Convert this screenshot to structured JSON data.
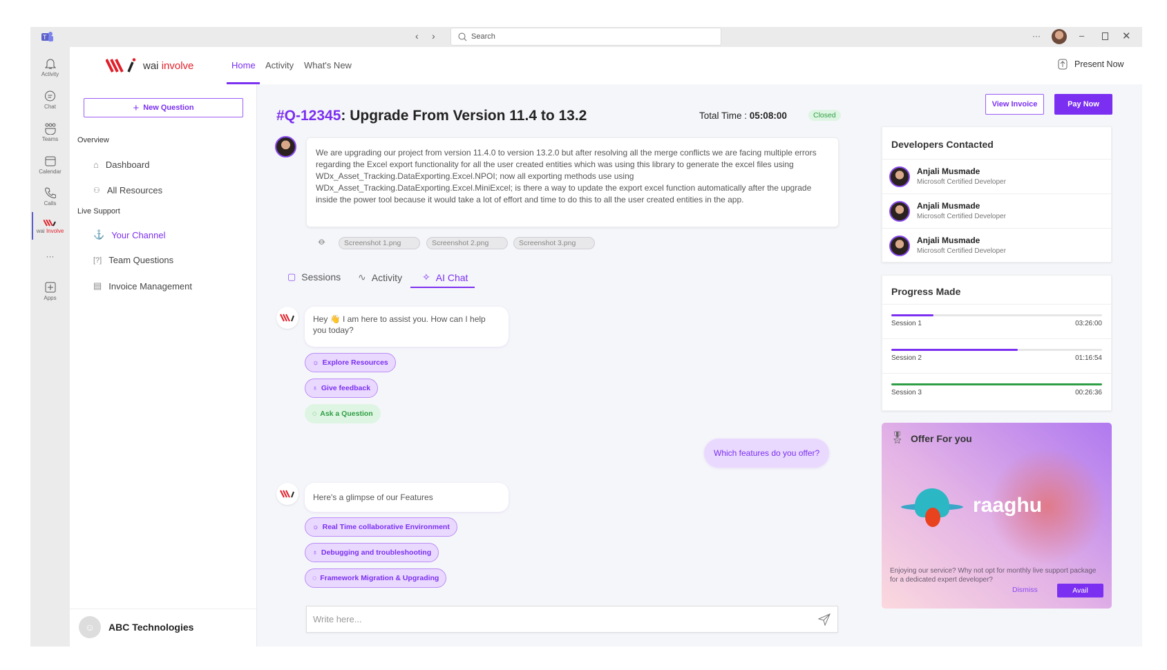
{
  "titlebar": {
    "search_placeholder": "Search"
  },
  "rail": [
    {
      "label": "Activity",
      "icon": "bell-icon"
    },
    {
      "label": "Chat",
      "icon": "chat-icon"
    },
    {
      "label": "Teams",
      "icon": "teams-icon"
    },
    {
      "label": "Calendar",
      "icon": "calendar-icon"
    },
    {
      "label": "Calls",
      "icon": "phone-icon"
    },
    {
      "label_a": "wai",
      "label_b": "Involve",
      "icon": "wai-involve-logo"
    },
    {
      "label": "Apps",
      "icon": "plus-square-icon"
    }
  ],
  "header": {
    "logo_a": "wai",
    "logo_b": "involve",
    "tabs": [
      "Home",
      "Activity",
      "What's New"
    ],
    "present": "Present Now"
  },
  "sidebar": {
    "new_question": "New Question",
    "overview": "Overview",
    "overview_items": [
      "Dashboard",
      "All Resources"
    ],
    "live_support": "Live Support",
    "live_items": [
      "Your Channel",
      "Team Questions",
      "Invoice Management"
    ],
    "org": "ABC Technologies"
  },
  "question": {
    "id": "#Q-12345",
    "title": ": Upgrade From Version 11.4 to 13.2",
    "total_time_label": "Total Time :",
    "total_time": "05:08:00",
    "status": "Closed",
    "description": "We are upgrading our project from version 11.4.0 to version 13.2.0 but after resolving all the merge conflicts we are facing multiple errors regarding the Excel export functionality for all the user created entities which was using this library to generate the excel files using WDx_Asset_Tracking.DataExporting.Excel.NPOI; now all exporting methods use using WDx_Asset_Tracking.DataExporting.Excel.MiniExcel; is there a way to update the export excel function automatically after the upgrade inside the power tool because it would take a lot of effort and time to do this to all the user created entities in the app.",
    "attachments": [
      "Screenshot 1.png",
      "Screenshot 2.png",
      "Screenshot 3.png"
    ]
  },
  "actions": {
    "view_invoice": "View Invoice",
    "pay_now": "Pay Now"
  },
  "tabs": [
    "Sessions",
    "Activity",
    "AI Chat"
  ],
  "chat": {
    "bot1": "Hey 👋 I am here to assist you. How can I help you today?",
    "chips1": [
      "Explore Resources",
      "Give feedback",
      "Ask a Question"
    ],
    "user1": "Which features do you offer?",
    "bot2": "Here's a glimpse of our Features",
    "chips2": [
      "Real Time collaborative Environment",
      "Debugging and troubleshooting",
      "Framework Migration & Upgrading"
    ],
    "input_placeholder": "Write here..."
  },
  "developers": {
    "title": "Developers Contacted",
    "items": [
      {
        "name": "Anjali Musmade",
        "role": "Microsoft Certified Developer"
      },
      {
        "name": "Anjali Musmade",
        "role": "Microsoft Certified Developer"
      },
      {
        "name": "Anjali Musmade",
        "role": "Microsoft Certified Developer"
      }
    ]
  },
  "progress": {
    "title": "Progress Made",
    "sessions": [
      {
        "label": "Session 1",
        "time": "03:26:00",
        "fraction": 0.2,
        "color": "#7b2ff0"
      },
      {
        "label": "Session 2",
        "time": "01:16:54",
        "fraction": 0.6,
        "color": "#7b2ff0"
      },
      {
        "label": "Session 3",
        "time": "00:26:36",
        "fraction": 1.0,
        "color": "#2e9e44"
      }
    ]
  },
  "offer": {
    "title": "Offer For you",
    "brand": "raaghu",
    "text": "Enjoying our service? Why not opt for monthly live support package for a dedicated expert developer?",
    "dismiss": "Dismiss",
    "avail": "Avail"
  },
  "colors": {
    "accent": "#7b2ff0",
    "brand_red": "#e0202a",
    "success": "#2e9e44"
  }
}
